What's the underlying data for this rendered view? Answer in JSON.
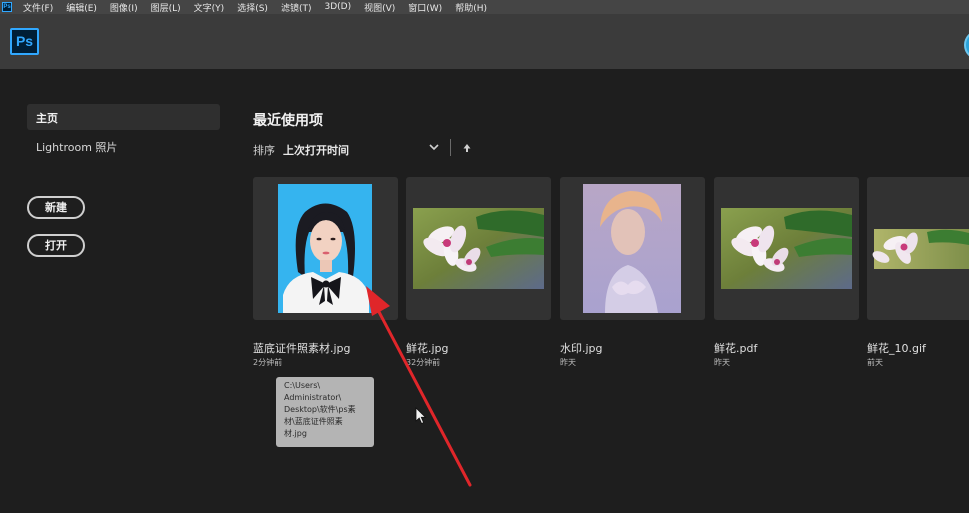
{
  "menubar": {
    "items": [
      "文件(F)",
      "编辑(E)",
      "图像(I)",
      "图层(L)",
      "文字(Y)",
      "选择(S)",
      "滤镜(T)",
      "3D(D)",
      "视图(V)",
      "窗口(W)",
      "帮助(H)"
    ]
  },
  "app": {
    "logo": "Ps"
  },
  "sidebar": {
    "home": "主页",
    "lightroom": "Lightroom 照片",
    "new_button": "新建",
    "open_button": "打开"
  },
  "recent": {
    "title": "最近使用项",
    "sort_label": "排序",
    "sort_value": "上次打开时间",
    "files": [
      {
        "name": "蓝底证件照素材.jpg",
        "time": "2分钟前"
      },
      {
        "name": "鲜花.jpg",
        "time": "32分钟前"
      },
      {
        "name": "水印.jpg",
        "time": "昨天"
      },
      {
        "name": "鲜花.pdf",
        "time": "昨天"
      },
      {
        "name": "鲜花_10.gif",
        "time": "前天"
      }
    ]
  },
  "tooltip": {
    "lines": [
      "C:\\Users\\",
      "Administrator\\",
      "Desktop\\软件\\ps素",
      "材\\蓝底证件照素",
      "材.jpg"
    ]
  },
  "colors": {
    "accent": "#31a8ff",
    "annotation": "#e0262a",
    "id_photo_bg": "#33b5f0"
  }
}
